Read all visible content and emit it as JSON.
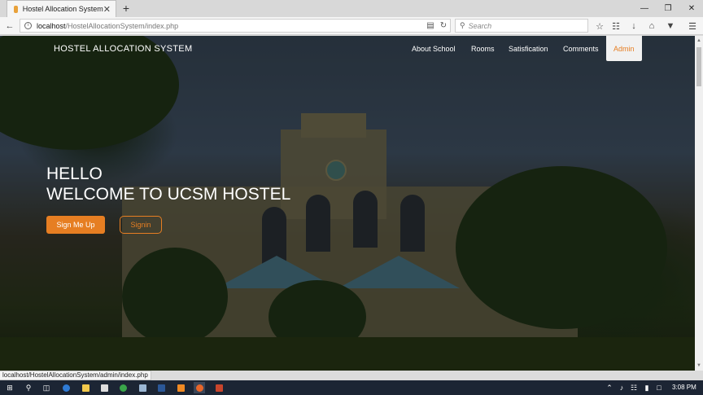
{
  "browser": {
    "tab_title": "Hostel Allocation System",
    "tab_close": "✕",
    "new_tab": "+",
    "url_host": "localhost",
    "url_path": "/HostelAllocationSystem/index.php",
    "search_placeholder": "Search",
    "status_url": "localhost/HostelAllocationSystem/admin/index.php"
  },
  "site": {
    "brand": "HOSTEL ALLOCATION SYSTEM",
    "nav": [
      {
        "label": "About School"
      },
      {
        "label": "Rooms"
      },
      {
        "label": "Satisfication"
      },
      {
        "label": "Comments"
      },
      {
        "label": "Admin",
        "active": true
      }
    ],
    "hero_line1": "HELLO",
    "hero_line2": "WELCOME TO UCSM HOSTEL",
    "signup_label": "Sign Me Up",
    "signin_label": "Signin"
  },
  "taskbar": {
    "time": "3:08 PM",
    "icons": [
      "windows-start-icon",
      "search-icon",
      "task-view-icon",
      "edge-icon",
      "file-explorer-icon",
      "store-icon",
      "xbox-icon",
      "notepad-icon",
      "word-icon",
      "sublime-icon",
      "firefox-icon",
      "powerpoint-icon"
    ]
  },
  "colors": {
    "accent": "#e67e22",
    "nav_active_bg": "#f1f1f1"
  }
}
